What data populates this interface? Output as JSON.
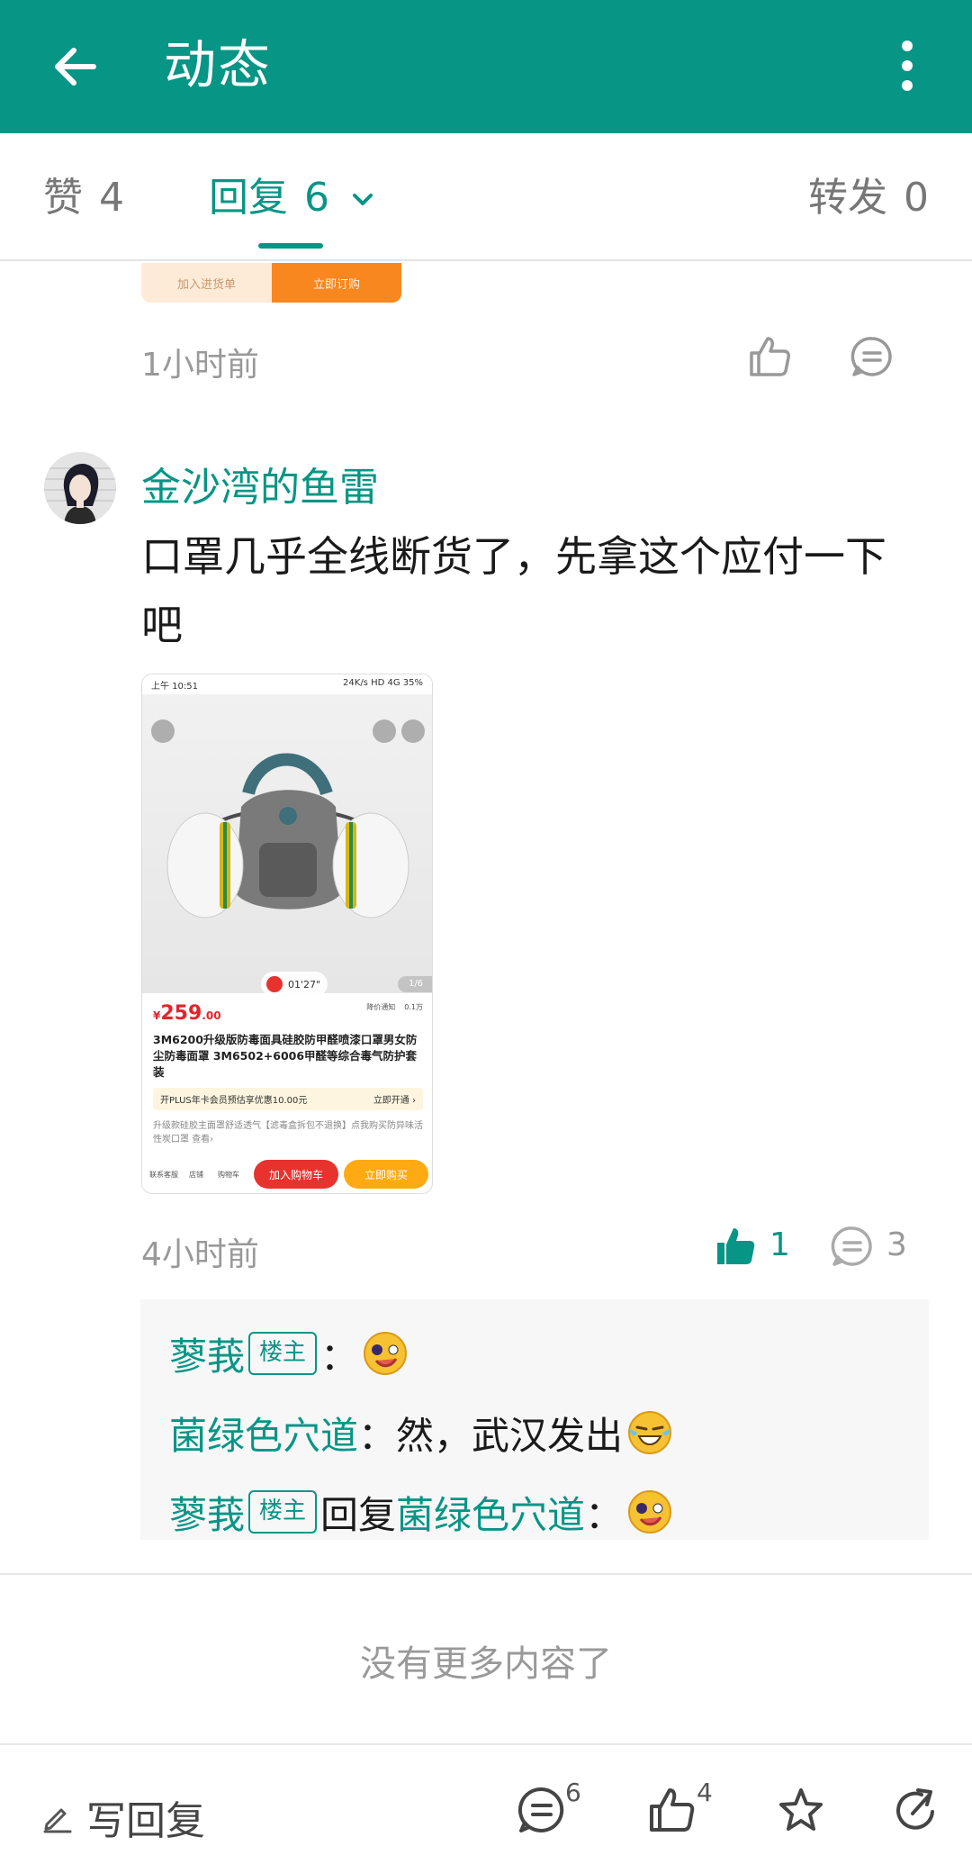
{
  "app_bar": {
    "title": "动态",
    "accent_color": "#079585"
  },
  "tabs": {
    "likes": {
      "label": "赞",
      "count": "4"
    },
    "replies": {
      "label": "回复",
      "count": "6"
    },
    "reposts": {
      "label": "转发",
      "count": "0"
    }
  },
  "previous_post": {
    "card_left": "加入进货单",
    "card_right": "立即订购",
    "time": "1小时前"
  },
  "comment": {
    "username": "金沙湾的鱼雷",
    "content": "口罩几乎全线断货了，先拿这个应付一下吧",
    "time": "4小时前",
    "like_count": "1",
    "reply_count": "3",
    "image": {
      "status_time": "上午 10:51",
      "status_right": "24K/s  HD 4G  35%",
      "video_duration": "01'27\"",
      "page": "1/6",
      "price_symbol": "¥",
      "price_main": "259",
      "price_decimal": ".00",
      "side_action_1": "降价通知",
      "side_action_2": "0.1万",
      "title": "3M6200升级版防毒面具硅胶防甲醛喷漆口罩男女防尘防毒面罩 3M6502+6006甲醛等综合毒气防护套装",
      "plus_text": "开PLUS年卡会员预估享优惠10.00元",
      "plus_action": "立即开通 ›",
      "promo": "升级款硅胶主面罩舒适透气【滤毒盒拆包不退换】点我购买防异味活性炭口罩 查看›",
      "mini_1": "联系客服",
      "mini_2": "店铺",
      "mini_3": "购物车",
      "cart_button": "加入购物车",
      "buy_button": "立即购买"
    }
  },
  "replies": [
    {
      "user": "蓼莪",
      "badge": "楼主",
      "text": "："
    },
    {
      "user": "菌绿色穴道",
      "text": "：然，武汉发出"
    },
    {
      "user": "蓼莪",
      "badge": "楼主",
      "mid": "回复",
      "target": "菌绿色穴道",
      "text": "："
    }
  ],
  "footer_text": "没有更多内容了",
  "bottom_bar": {
    "write_label": "写回复",
    "comment_count": "6",
    "like_count": "4"
  }
}
